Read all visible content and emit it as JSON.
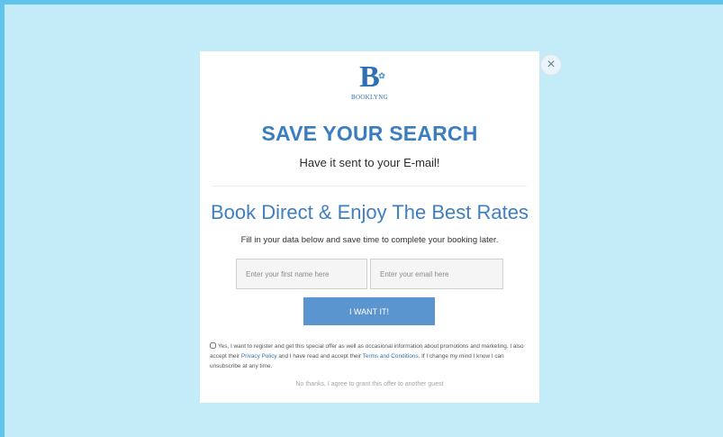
{
  "colors": {
    "frame": "#5ec4ee",
    "overlay": "#c3ecf8",
    "accent": "#3a7ec0",
    "button": "#5b95cf"
  },
  "logo": {
    "mark": "B",
    "text": "BOOKLYNG"
  },
  "close": {
    "icon": "close-icon",
    "glyph": "×"
  },
  "popup": {
    "title": "SAVE YOUR SEARCH",
    "subtitle": "Have it sent to your E-mail!",
    "headline": "Book Direct & Enjoy The Best Rates",
    "instructions": "Fill in your data below and save time to complete your booking later."
  },
  "form": {
    "first_name": {
      "placeholder": "Enter your first name here",
      "value": ""
    },
    "email": {
      "placeholder": "Enter your email here",
      "value": ""
    },
    "submit_label": "I WANT IT!"
  },
  "consent": {
    "checked": false,
    "text_before": "Yes, I want to register and get this special offer as well as occasional information about promotions and marketing. I also accept their ",
    "privacy_link": "Privacy Policy",
    "text_middle": " and I have read and accept their ",
    "terms_link": "Terms and Conditions",
    "text_after": ". If I change my mind I know I can unsubscribe at any time."
  },
  "decline_label": "No thanks, I agree to grant this offer to another guest"
}
